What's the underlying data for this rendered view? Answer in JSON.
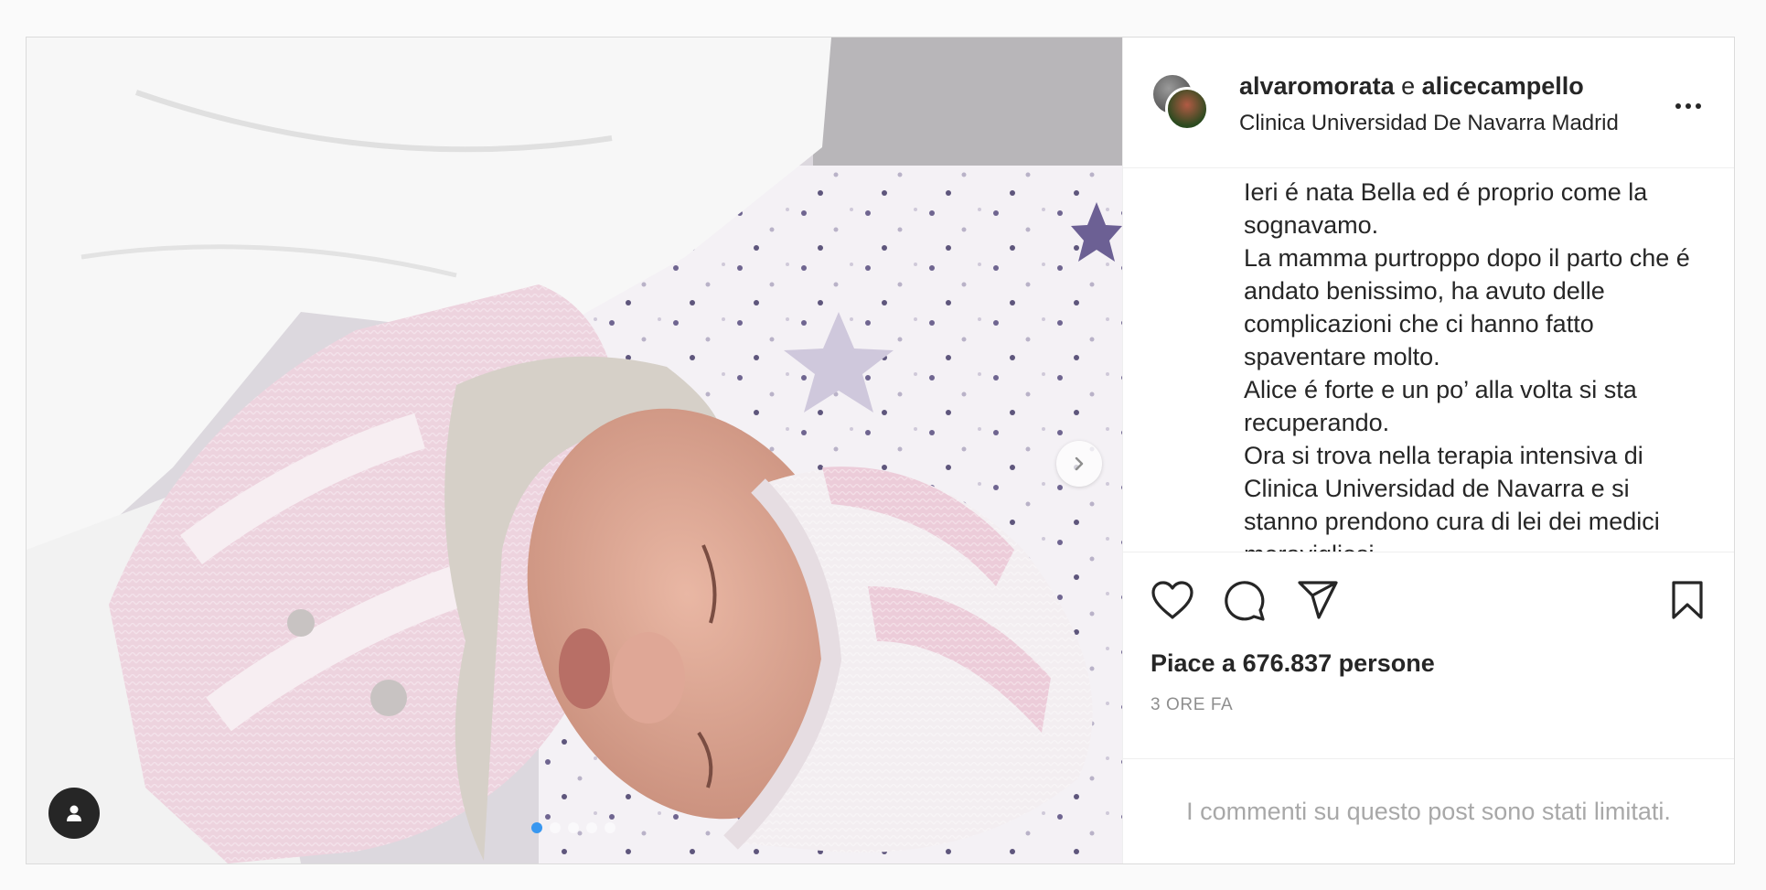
{
  "post": {
    "owners": {
      "first": "alvaromorata",
      "joiner": "e",
      "second": "alicecampello"
    },
    "location": "Clinica Universidad De Navarra Madrid",
    "caption_lines": [
      "Ieri é nata Bella ed é proprio come la sognavamo.",
      "La mamma purtroppo dopo il parto che é andato benissimo, ha avuto delle complicazioni che ci hanno fatto spaventare molto.",
      "Alice é forte e un po’ alla volta si sta recuperando.",
      "Ora si trova nella terapia intensiva di Clinica Universidad de Navarra e si stanno prendono cura di lei dei medici meravigliosi."
    ],
    "likes_text": "Piace a 676.837 persone",
    "time_ago": "3 ORE FA",
    "comments_notice": "I commenti su questo post sono stati limitati.",
    "carousel": {
      "count": 5,
      "active_index": 0
    }
  },
  "icons": {
    "more": "more-options-icon",
    "like": "heart-icon",
    "comment": "comment-bubble-icon",
    "share": "paper-plane-icon",
    "save": "bookmark-icon",
    "next": "chevron-right-icon",
    "tags": "user-tag-icon"
  },
  "colors": {
    "accent": "#3897f0",
    "text": "#262626",
    "muted": "#8e8e8e"
  }
}
